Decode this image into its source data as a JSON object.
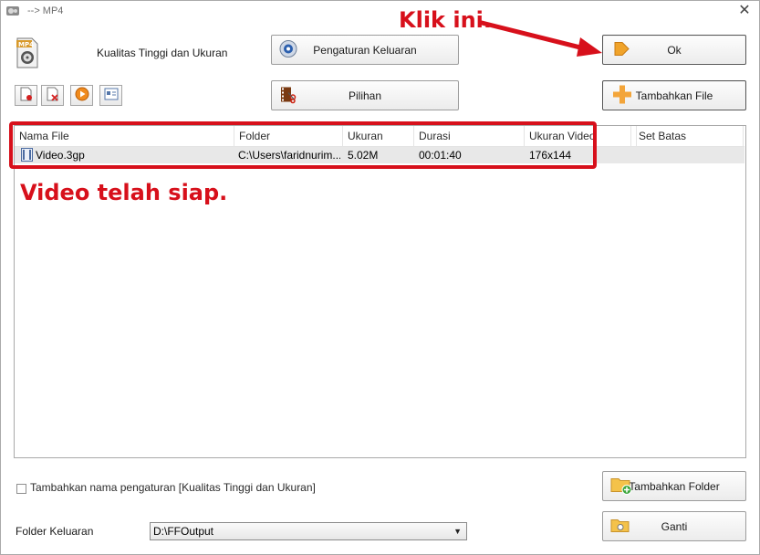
{
  "window": {
    "title": "--> MP4",
    "close_glyph": "✕"
  },
  "profile": {
    "label": "Kualitas Tinggi dan Ukuran",
    "icon": "mp4-file-icon"
  },
  "toolbar": {
    "output_settings": "Pengaturan Keluaran",
    "options": "Pilihan",
    "ok": "Ok",
    "add_file": "Tambahkan File",
    "add_folder": "Tambahkan Folder",
    "change": "Ganti"
  },
  "file_list": {
    "columns": [
      "Nama File",
      "Folder",
      "Ukuran",
      "Durasi",
      "Ukuran Video",
      "",
      "Set Batas"
    ],
    "rows": [
      {
        "name": "Video.3gp",
        "folder": "C:\\Users\\faridnurim...",
        "size": "5.02M",
        "duration": "00:01:40",
        "video_size": "176x144",
        "limit": ""
      }
    ]
  },
  "annotations": {
    "click_here": "Klik ini.",
    "video_ready": "Video telah siap.",
    "color": "#d7101b"
  },
  "footer": {
    "append_setting_name": "Tambahkan nama pengaturan [Kualitas Tinggi dan Ukuran]",
    "output_folder_label": "Folder Keluaran",
    "output_folder_value": "D:\\FFOutput"
  }
}
